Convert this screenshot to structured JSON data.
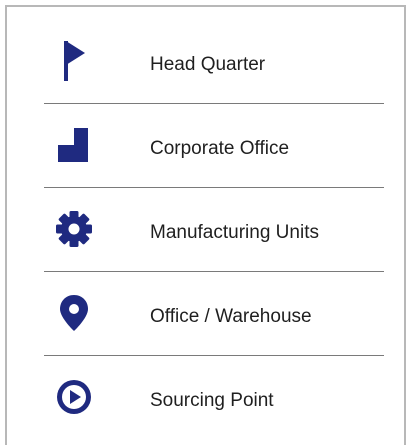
{
  "legend": {
    "icon_color": "#1f2a80",
    "items": [
      {
        "icon": "flag-icon",
        "label": "Head Quarter"
      },
      {
        "icon": "building-block-icon",
        "label": "Corporate Office"
      },
      {
        "icon": "gear-icon",
        "label": "Manufacturing Units"
      },
      {
        "icon": "map-pin-icon",
        "label": "Office / Warehouse"
      },
      {
        "icon": "play-circle-icon",
        "label": "Sourcing Point"
      }
    ]
  }
}
